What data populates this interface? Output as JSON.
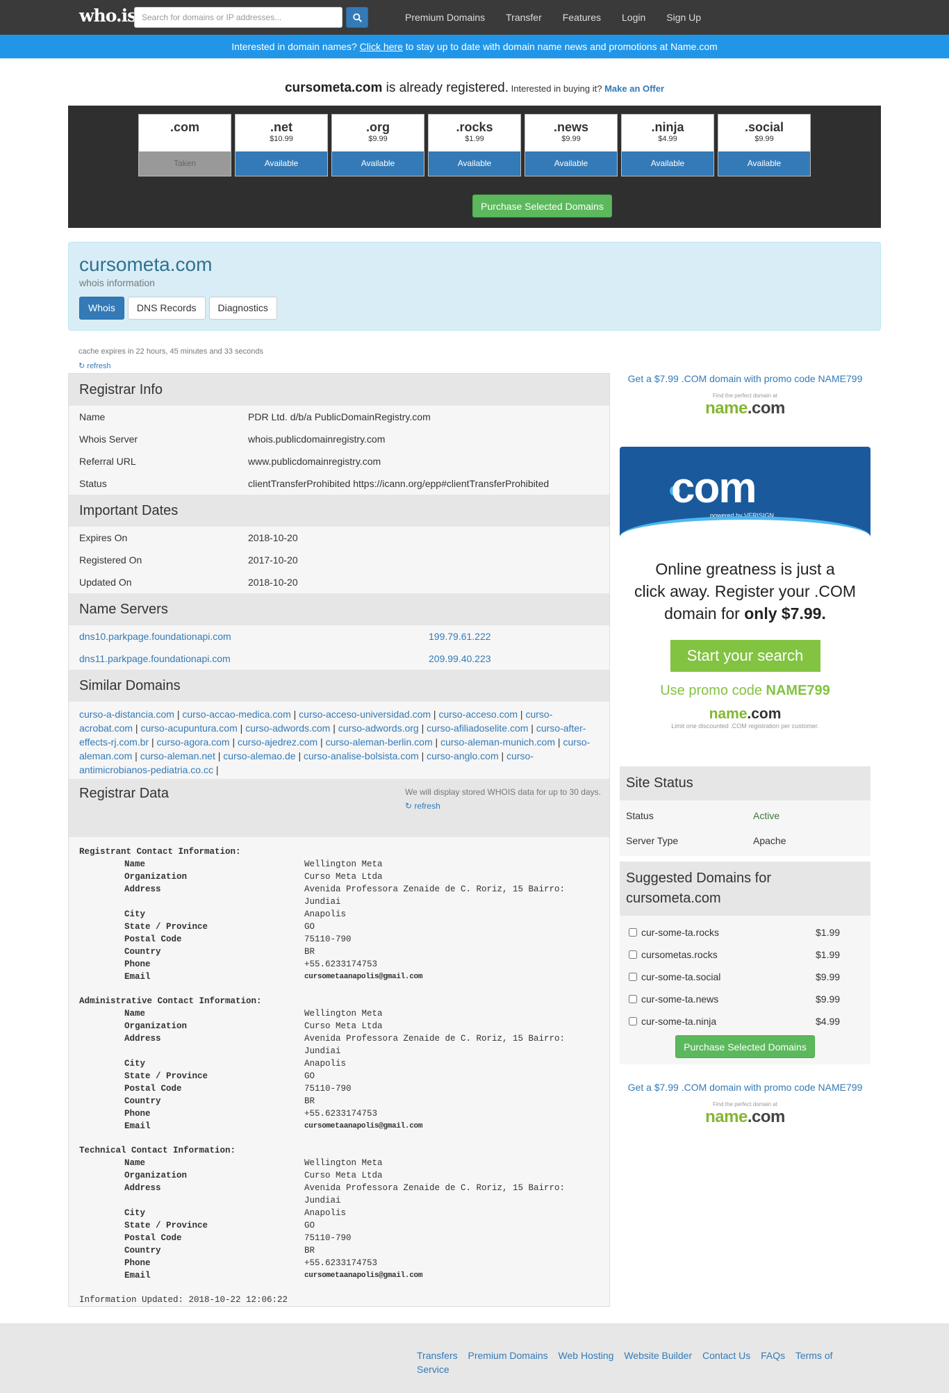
{
  "nav": {
    "logo": "who.is",
    "search_placeholder": "Search for domains or IP addresses...",
    "links": [
      "Premium Domains",
      "Transfer",
      "Features",
      "Login",
      "Sign Up"
    ]
  },
  "promo_bar": {
    "before": "Interested in domain names? ",
    "link": "Click here",
    "after": " to stay up to date with domain name news and promotions at Name.com"
  },
  "headline": {
    "domain": "cursometa.com",
    "registered": " is already registered.",
    "interest": " Interested in buying it? ",
    "offer": "Make an Offer"
  },
  "tlds": [
    {
      "name": ".com",
      "price": "",
      "status": "Taken"
    },
    {
      "name": ".net",
      "price": "$10.99",
      "status": "Available"
    },
    {
      "name": ".org",
      "price": "$9.99",
      "status": "Available"
    },
    {
      "name": ".rocks",
      "price": "$1.99",
      "status": "Available"
    },
    {
      "name": ".news",
      "price": "$9.99",
      "status": "Available"
    },
    {
      "name": ".ninja",
      "price": "$4.99",
      "status": "Available"
    },
    {
      "name": ".social",
      "price": "$9.99",
      "status": "Available"
    }
  ],
  "purchase_label": "Purchase Selected Domains",
  "info_panel": {
    "title": "cursometa.com",
    "subtitle": "whois information",
    "tabs": [
      "Whois",
      "DNS Records",
      "Diagnostics"
    ]
  },
  "cache": {
    "note": "cache expires in 22 hours, 45 minutes and 33 seconds",
    "refresh": "refresh"
  },
  "registrar_info": {
    "heading": "Registrar Info",
    "rows": [
      {
        "k": "Name",
        "v": "PDR Ltd. d/b/a PublicDomainRegistry.com"
      },
      {
        "k": "Whois Server",
        "v": "whois.publicdomainregistry.com"
      },
      {
        "k": "Referral URL",
        "v": "www.publicdomainregistry.com"
      },
      {
        "k": "Status",
        "v": "clientTransferProhibited https://icann.org/epp#clientTransferProhibited"
      }
    ]
  },
  "important_dates": {
    "heading": "Important Dates",
    "rows": [
      {
        "k": "Expires On",
        "v": "2018-10-20"
      },
      {
        "k": "Registered On",
        "v": "2017-10-20"
      },
      {
        "k": "Updated On",
        "v": "2018-10-20"
      }
    ]
  },
  "name_servers": {
    "heading": "Name Servers",
    "rows": [
      {
        "host": "dns10.parkpage.foundationapi.com",
        "ip": "199.79.61.222"
      },
      {
        "host": "dns11.parkpage.foundationapi.com",
        "ip": "209.99.40.223"
      }
    ]
  },
  "similar_domains": {
    "heading": "Similar Domains",
    "items": [
      "curso-a-distancia.com",
      "curso-accao-medica.com",
      "curso-acceso-universidad.com",
      "curso-acceso.com",
      "curso-acrobat.com",
      "curso-acupuntura.com",
      "curso-adwords.com",
      "curso-adwords.org",
      "curso-afiliadoselite.com",
      "curso-after-effects-rj.com.br",
      "curso-agora.com",
      "curso-ajedrez.com",
      "curso-aleman-berlin.com",
      "curso-aleman-munich.com",
      "curso-aleman.com",
      "curso-aleman.net",
      "curso-alemao.de",
      "curso-analise-bolsista.com",
      "curso-anglo.com",
      "curso-antimicrobianos-pediatria.co.cc"
    ]
  },
  "registrar_data": {
    "heading": "Registrar Data",
    "note": "We will display stored WHOIS data for up to 30 days.",
    "refresh": "refresh",
    "groups": [
      {
        "title": "Registrant Contact Information:",
        "lines": [
          {
            "k": "Name",
            "v": "Wellington Meta"
          },
          {
            "k": "Organization",
            "v": "Curso Meta Ltda"
          },
          {
            "k": "Address",
            "v": "Avenida Professora Zenaide de C. Roriz, 15 Bairro: Jundiai"
          },
          {
            "k": "City",
            "v": "Anapolis"
          },
          {
            "k": "State / Province",
            "v": "GO"
          },
          {
            "k": "Postal Code",
            "v": "75110-790"
          },
          {
            "k": "Country",
            "v": "BR"
          },
          {
            "k": "Phone",
            "v": "+55.6233174753"
          },
          {
            "k": "Email",
            "v": "cursometaanapolis@gmail.com"
          }
        ]
      },
      {
        "title": "Administrative Contact Information:",
        "lines": [
          {
            "k": "Name",
            "v": "Wellington Meta"
          },
          {
            "k": "Organization",
            "v": "Curso Meta Ltda"
          },
          {
            "k": "Address",
            "v": "Avenida Professora Zenaide de C. Roriz, 15 Bairro: Jundiai"
          },
          {
            "k": "City",
            "v": "Anapolis"
          },
          {
            "k": "State / Province",
            "v": "GO"
          },
          {
            "k": "Postal Code",
            "v": "75110-790"
          },
          {
            "k": "Country",
            "v": "BR"
          },
          {
            "k": "Phone",
            "v": "+55.6233174753"
          },
          {
            "k": "Email",
            "v": "cursometaanapolis@gmail.com"
          }
        ]
      },
      {
        "title": "Technical Contact Information:",
        "lines": [
          {
            "k": "Name",
            "v": "Wellington Meta"
          },
          {
            "k": "Organization",
            "v": "Curso Meta Ltda"
          },
          {
            "k": "Address",
            "v": "Avenida Professora Zenaide de C. Roriz, 15 Bairro: Jundiai"
          },
          {
            "k": "City",
            "v": "Anapolis"
          },
          {
            "k": "State / Province",
            "v": "GO"
          },
          {
            "k": "Postal Code",
            "v": "75110-790"
          },
          {
            "k": "Country",
            "v": "BR"
          },
          {
            "k": "Phone",
            "v": "+55.6233174753"
          },
          {
            "k": "Email",
            "v": "cursometaanapolis@gmail.com"
          }
        ]
      }
    ],
    "updated": "Information Updated: 2018-10-22 12:06:22"
  },
  "sidebar": {
    "promo_link": "Get a $7.99 .COM domain with promo code NAME799",
    "namecom_tiny": "Find the perfect domain at",
    "namecom_name": "name",
    "namecom_com": ".com",
    "ad": {
      "dotcom": "com",
      "powered": "powered by VERISIGN",
      "text1": "Online greatness is just a",
      "text2": "click away. Register your .COM",
      "text3": "domain for ",
      "text3_bold": "only $7.99.",
      "button": "Start your search",
      "promo_prefix": "Use promo code ",
      "promo_code": "NAME799",
      "logo_name": "name",
      "logo_com": ".com",
      "fine": "Limit one discounted .COM registration per customer."
    },
    "site_status": {
      "heading": "Site Status",
      "rows": [
        {
          "k": "Status",
          "v": "Active"
        },
        {
          "k": "Server Type",
          "v": "Apache"
        }
      ]
    },
    "suggested": {
      "heading": "Suggested Domains for cursometa.com",
      "items": [
        {
          "name": "cur-some-ta.rocks",
          "price": "$1.99"
        },
        {
          "name": "cursometas.rocks",
          "price": "$1.99"
        },
        {
          "name": "cur-some-ta.social",
          "price": "$9.99"
        },
        {
          "name": "cur-some-ta.news",
          "price": "$9.99"
        },
        {
          "name": "cur-some-ta.ninja",
          "price": "$4.99"
        }
      ]
    }
  },
  "footer": {
    "links": [
      "Transfers",
      "Premium Domains",
      "Web Hosting",
      "Website Builder",
      "Contact Us",
      "FAQs",
      "Terms of Service"
    ]
  },
  "colors": {
    "nav_bg": "#3a3a3a",
    "promo_bar": "#2196e8",
    "link": "#337ab7",
    "available": "#337ab7",
    "taken": "#999999",
    "purchase": "#5cb85c",
    "namecom_green": "#83b731",
    "verisign_blue": "#1a5a9c"
  }
}
